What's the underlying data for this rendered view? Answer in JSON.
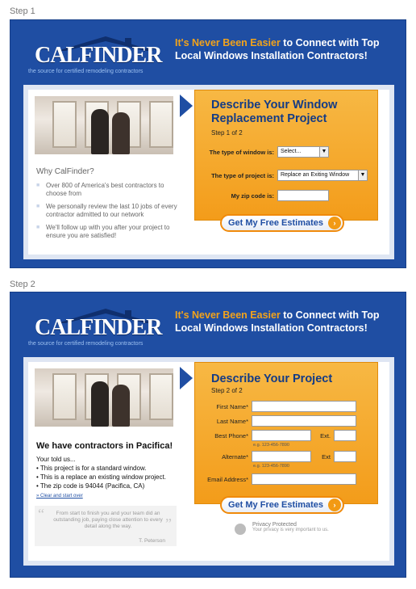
{
  "step1": {
    "label": "Step 1",
    "header": {
      "logo": "CALFINDER",
      "logo_tagline": "the source for certified remodeling contractors",
      "tagline_highlight": "It's Never Been Easier",
      "tagline_rest": " to Connect with Top Local Windows Installation Contractors!"
    },
    "why_title": "Why CalFinder?",
    "bullets": [
      "Over 800 of America's best contractors to choose from",
      "We personally review the last 10 jobs of every contractor admitted to our network",
      "We'll follow up with you after your project to ensure you are satisfied!"
    ],
    "form": {
      "title_line1": "Describe Your Window",
      "title_line2": "Replacement Project",
      "step": "Step 1 of 2",
      "window_type_label": "The type of window is:",
      "window_type_value": "Select...",
      "project_type_label": "The type of project is:",
      "project_type_value": "Replace an Exiting Window",
      "zip_label": "My zip code is:",
      "zip_value": "",
      "cta": "Get My Free Estimates"
    }
  },
  "step2": {
    "label": "Step 2",
    "header": {
      "logo": "CALFINDER",
      "logo_tagline": "the source for certified remodeling contractors",
      "tagline_highlight": "It's Never Been Easier",
      "tagline_rest": " to Connect with Top Local Windows Installation Contractors!"
    },
    "summary_title": "We have contractors in Pacifica!",
    "summary_lines": [
      "Your told us...",
      "• This project is for a standard window.",
      "• This is a replace an existing window project.",
      "• The zip code is 94044 (Pacifica, CA)"
    ],
    "clear_link": "» Clear and start over",
    "quote": {
      "text": "From start to finish you and your team did an outstanding job, paying close attention to every detail along the way.",
      "author": "T. Peterson"
    },
    "form": {
      "title": "Describe Your Project",
      "step": "Step 2 of 2",
      "first_name_label": "First Name*",
      "last_name_label": "Last Name*",
      "best_phone_label": "Best Phone*",
      "ext_label": "Ext.",
      "phone_hint": "e.g. 123-456-7890",
      "alternate_label": "Alternate*",
      "ext2_label": "Ext",
      "alt_hint": "e.g. 123-456-7890",
      "email_label": "Email Address*",
      "cta": "Get My Free Estimates"
    },
    "privacy": {
      "title": "Privacy Protected",
      "subtitle": "Your privacy is very important to us."
    }
  },
  "colors": {
    "brand_blue": "#1f4ea3",
    "accent_orange": "#f4a21b",
    "title_blue": "#133b86"
  }
}
